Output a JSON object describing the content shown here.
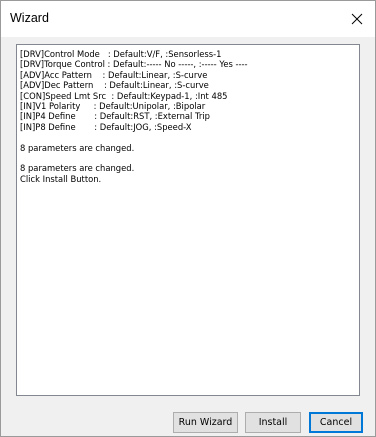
{
  "window": {
    "title": "Wizard"
  },
  "title_bar": {
    "close_icon": "close-x"
  },
  "log": {
    "lines": [
      "[DRV]Control Mode   : Default:V/F, :Sensorless-1",
      "[DRV]Torque Control : Default:----- No -----, :----- Yes ----",
      "[ADV]Acc Pattern    : Default:Linear, :S-curve",
      "[ADV]Dec Pattern    : Default:Linear, :S-curve",
      "[CON]Speed Lmt Src  : Default:Keypad-1, :Int 485",
      "[IN]V1 Polarity     : Default:Unipolar, :Bipolar",
      "[IN]P4 Define       : Default:RST, :External Trip",
      "[IN]P8 Define       : Default:JOG, :Speed-X",
      "",
      "8 parameters are changed.",
      "",
      "8 parameters are changed.",
      "Click Install Button."
    ]
  },
  "buttons": {
    "run_wizard": "Run Wizard",
    "install": "Install",
    "cancel": "Cancel"
  },
  "colors": {
    "focus_border": "#0078d7",
    "dialog_background": "#f0f0f0"
  }
}
